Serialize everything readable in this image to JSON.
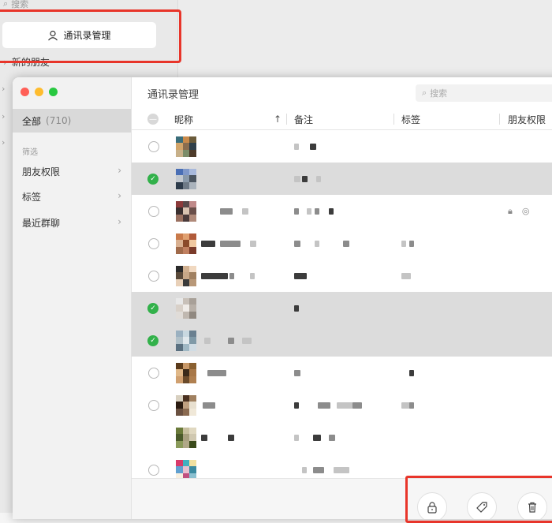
{
  "background": {
    "search_placeholder": "搜索",
    "manage_button_label": "通讯录管理",
    "new_friends_label": "新的朋友"
  },
  "dialog": {
    "title": "通讯录管理",
    "search_placeholder": "搜索",
    "sidebar": {
      "all_label": "全部",
      "all_count": "(710)",
      "filter_label": "筛选",
      "items": [
        {
          "label": "朋友权限"
        },
        {
          "label": "标签"
        },
        {
          "label": "最近群聊"
        }
      ]
    },
    "table": {
      "columns": {
        "nickname": "昵称",
        "note": "备注",
        "tag": "标签",
        "permission": "朋友权限"
      },
      "sort_indicator": "↑"
    },
    "rows": [
      {
        "selected": false
      },
      {
        "selected": true
      },
      {
        "selected": false
      },
      {
        "selected": false
      },
      {
        "selected": false
      },
      {
        "selected": true
      },
      {
        "selected": true
      },
      {
        "selected": false
      },
      {
        "selected": false
      },
      {
        "selected": false
      },
      {
        "selected": false
      }
    ]
  },
  "colors": {
    "highlight_box": "#e8352a",
    "check_green": "#32b14a"
  }
}
